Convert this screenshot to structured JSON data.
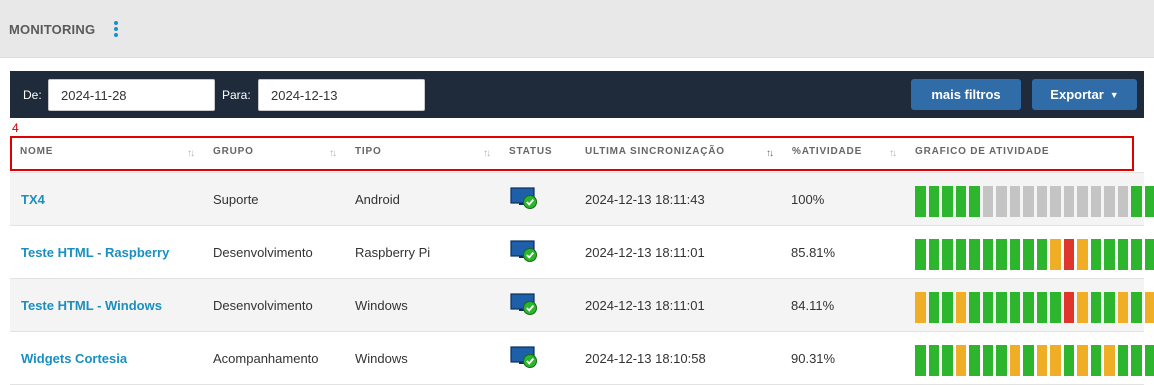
{
  "header": {
    "title": "MONITORING"
  },
  "filters": {
    "from_label": "De:",
    "from_value": "2024-11-28",
    "to_label": "Para:",
    "to_value": "2024-12-13",
    "more_filters_label": "mais filtros",
    "export_label": "Exportar"
  },
  "table": {
    "count": "4",
    "columns": [
      "NOME",
      "GRUPO",
      "TIPO",
      "STATUS",
      "ULTIMA SINCRONIZAÇÃO",
      "%ATIVIDADE",
      "GRAFICO DE ATIVIDADE"
    ],
    "colors": {
      "green": "#2db52d",
      "gray": "#c4c4c4",
      "orange": "#f0ad26",
      "red": "#e0352b"
    },
    "rows": [
      {
        "name": "TX4",
        "group": "Suporte",
        "type": "Android",
        "status_icon": "monitor-online-icon",
        "last_sync": "2024-12-13 18:11:43",
        "activity": "100%",
        "graph": [
          "green",
          "green",
          "green",
          "green",
          "green",
          "gray",
          "gray",
          "gray",
          "gray",
          "gray",
          "gray",
          "gray",
          "gray",
          "gray",
          "gray",
          "gray",
          "green",
          "green"
        ]
      },
      {
        "name": "Teste HTML - Raspberry",
        "group": "Desenvolvimento",
        "type": "Raspberry Pi",
        "status_icon": "monitor-online-icon",
        "last_sync": "2024-12-13 18:11:01",
        "activity": "85.81%",
        "graph": [
          "green",
          "green",
          "green",
          "green",
          "green",
          "green",
          "green",
          "green",
          "green",
          "green",
          "orange",
          "red",
          "orange",
          "green",
          "green",
          "green",
          "green",
          "green"
        ]
      },
      {
        "name": "Teste HTML - Windows",
        "group": "Desenvolvimento",
        "type": "Windows",
        "status_icon": "monitor-online-icon",
        "last_sync": "2024-12-13 18:11:01",
        "activity": "84.11%",
        "graph": [
          "orange",
          "green",
          "green",
          "orange",
          "green",
          "green",
          "green",
          "green",
          "green",
          "green",
          "green",
          "red",
          "orange",
          "green",
          "green",
          "orange",
          "green",
          "orange"
        ]
      },
      {
        "name": "Widgets Cortesia",
        "group": "Acompanhamento",
        "type": "Windows",
        "status_icon": "monitor-online-icon",
        "last_sync": "2024-12-13 18:10:58",
        "activity": "90.31%",
        "graph": [
          "green",
          "green",
          "green",
          "orange",
          "green",
          "green",
          "green",
          "orange",
          "green",
          "orange",
          "orange",
          "green",
          "orange",
          "green",
          "orange",
          "green",
          "green",
          "green"
        ]
      }
    ]
  }
}
